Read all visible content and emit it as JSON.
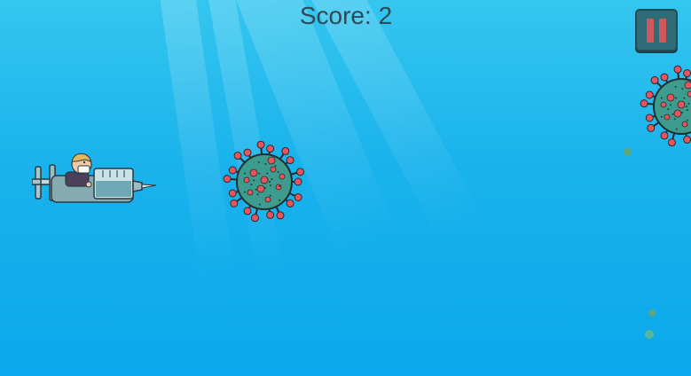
{
  "hud": {
    "score_text": "Score: 2",
    "pause_icon": "pause-icon"
  },
  "player": {
    "type": "syringe-plane",
    "pilot": "masked-pilot"
  },
  "enemies": [
    "coronavirus",
    "coronavirus"
  ],
  "colors": {
    "sky_top": "#35c6ef",
    "sky_bottom": "#0aa8ec",
    "score_text": "#2a4b59",
    "pause_bg": "#2f6c78",
    "pause_bars": "#d0575c",
    "virus_body": "#3e9c8e",
    "virus_spike": "#e8545d"
  }
}
